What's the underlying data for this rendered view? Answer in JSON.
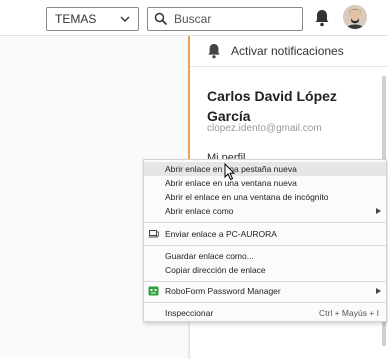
{
  "header": {
    "topics_select_value": "TEMAS",
    "search_placeholder": "Buscar",
    "icons": {
      "chevron": "chevron-down-icon",
      "search": "search-icon",
      "bell": "bell-icon",
      "avatar": "user-avatar"
    }
  },
  "profile_panel": {
    "notifications_label": "Activar notificaciones",
    "user_name": "Carlos David López García",
    "user_email": "clopez.idento@gmail.com",
    "my_profile_label": "Mi perfil",
    "accent_color": "#f0a050"
  },
  "context_menu": {
    "groups": [
      [
        {
          "label": "Abrir enlace en una pestaña nueva",
          "highlighted": true
        },
        {
          "label": "Abrir enlace en una ventana nueva"
        },
        {
          "label": "Abrir el enlace en una ventana de incógnito"
        },
        {
          "label": "Abrir enlace como",
          "submenu": true
        }
      ],
      [
        {
          "label": "Enviar enlace a PC-AURORA",
          "icon": "laptop-icon"
        }
      ],
      [
        {
          "label": "Guardar enlace como..."
        },
        {
          "label": "Copiar dirección de enlace"
        }
      ],
      [
        {
          "label": "RoboForm Password Manager",
          "icon": "roboform-icon",
          "submenu": true
        }
      ],
      [
        {
          "label": "Inspeccionar",
          "shortcut": "Ctrl + Mayús + I"
        }
      ]
    ]
  }
}
